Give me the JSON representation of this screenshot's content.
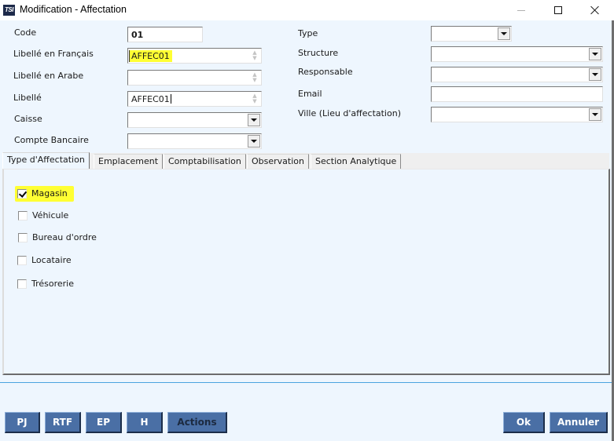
{
  "window": {
    "title": "Modification - Affectation",
    "logo_text": "TSI"
  },
  "form_left": {
    "code": {
      "label": "Code",
      "value": "01"
    },
    "libelle_fr": {
      "label": "Libellé en Français",
      "value": "AFFEC01"
    },
    "libelle_ar": {
      "label": "Libellé en Arabe",
      "value": ""
    },
    "libelle": {
      "label": "Libellé",
      "value": "AFFEC01"
    },
    "caisse": {
      "label": "Caisse",
      "value": ""
    },
    "compte_bancaire": {
      "label": "Compte Bancaire",
      "value": ""
    }
  },
  "form_right": {
    "type": {
      "label": "Type",
      "value": ""
    },
    "structure": {
      "label": "Structure",
      "value": ""
    },
    "responsable": {
      "label": "Responsable",
      "value": ""
    },
    "email": {
      "label": "Email",
      "value": ""
    },
    "ville": {
      "label": "Ville (Lieu d'affectation)",
      "value": ""
    }
  },
  "tabs": [
    {
      "label": "Type d'Affectation",
      "active": true
    },
    {
      "label": "Emplacement",
      "active": false
    },
    {
      "label": "Comptabilisation",
      "active": false
    },
    {
      "label": "Observation",
      "active": false
    },
    {
      "label": "Section Analytique",
      "active": false
    }
  ],
  "checkboxes": [
    {
      "label": "Magasin",
      "checked": true
    },
    {
      "label": "Véhicule",
      "checked": false
    },
    {
      "label": "Bureau d'ordre",
      "checked": false
    },
    {
      "label": "Locataire",
      "checked": false
    },
    {
      "label": "Trésorerie",
      "checked": false
    }
  ],
  "buttons": {
    "pj": "PJ",
    "rtf": "RTF",
    "ep": "EP",
    "h": "H",
    "actions": "Actions",
    "ok": "Ok",
    "annuler": "Annuler"
  },
  "colors": {
    "highlight": "#ffff33",
    "button_bg": "#4a6fa5",
    "background": "#eef6fe",
    "separator": "#4aa3df"
  }
}
